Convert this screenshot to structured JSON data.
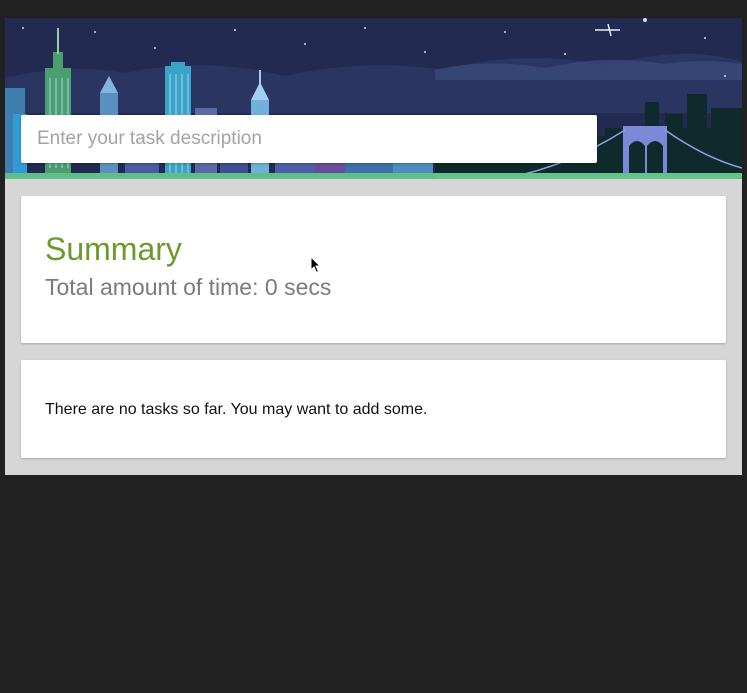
{
  "task_input": {
    "placeholder": "Enter your task description",
    "value": ""
  },
  "summary": {
    "title": "Summary",
    "total_time_text": "Total amount of time: 0 secs"
  },
  "tasks": {
    "empty_message": "There are no tasks so far. You may want to add some."
  },
  "colors": {
    "page_background": "#212121",
    "app_background": "#d6d6d6",
    "card_background": "#ffffff",
    "summary_title": "#6a9a2c",
    "total_time_text": "#7b7b7b",
    "banner_sky": "#222a52"
  },
  "icons": {
    "cursor": "mouse-pointer-icon"
  }
}
